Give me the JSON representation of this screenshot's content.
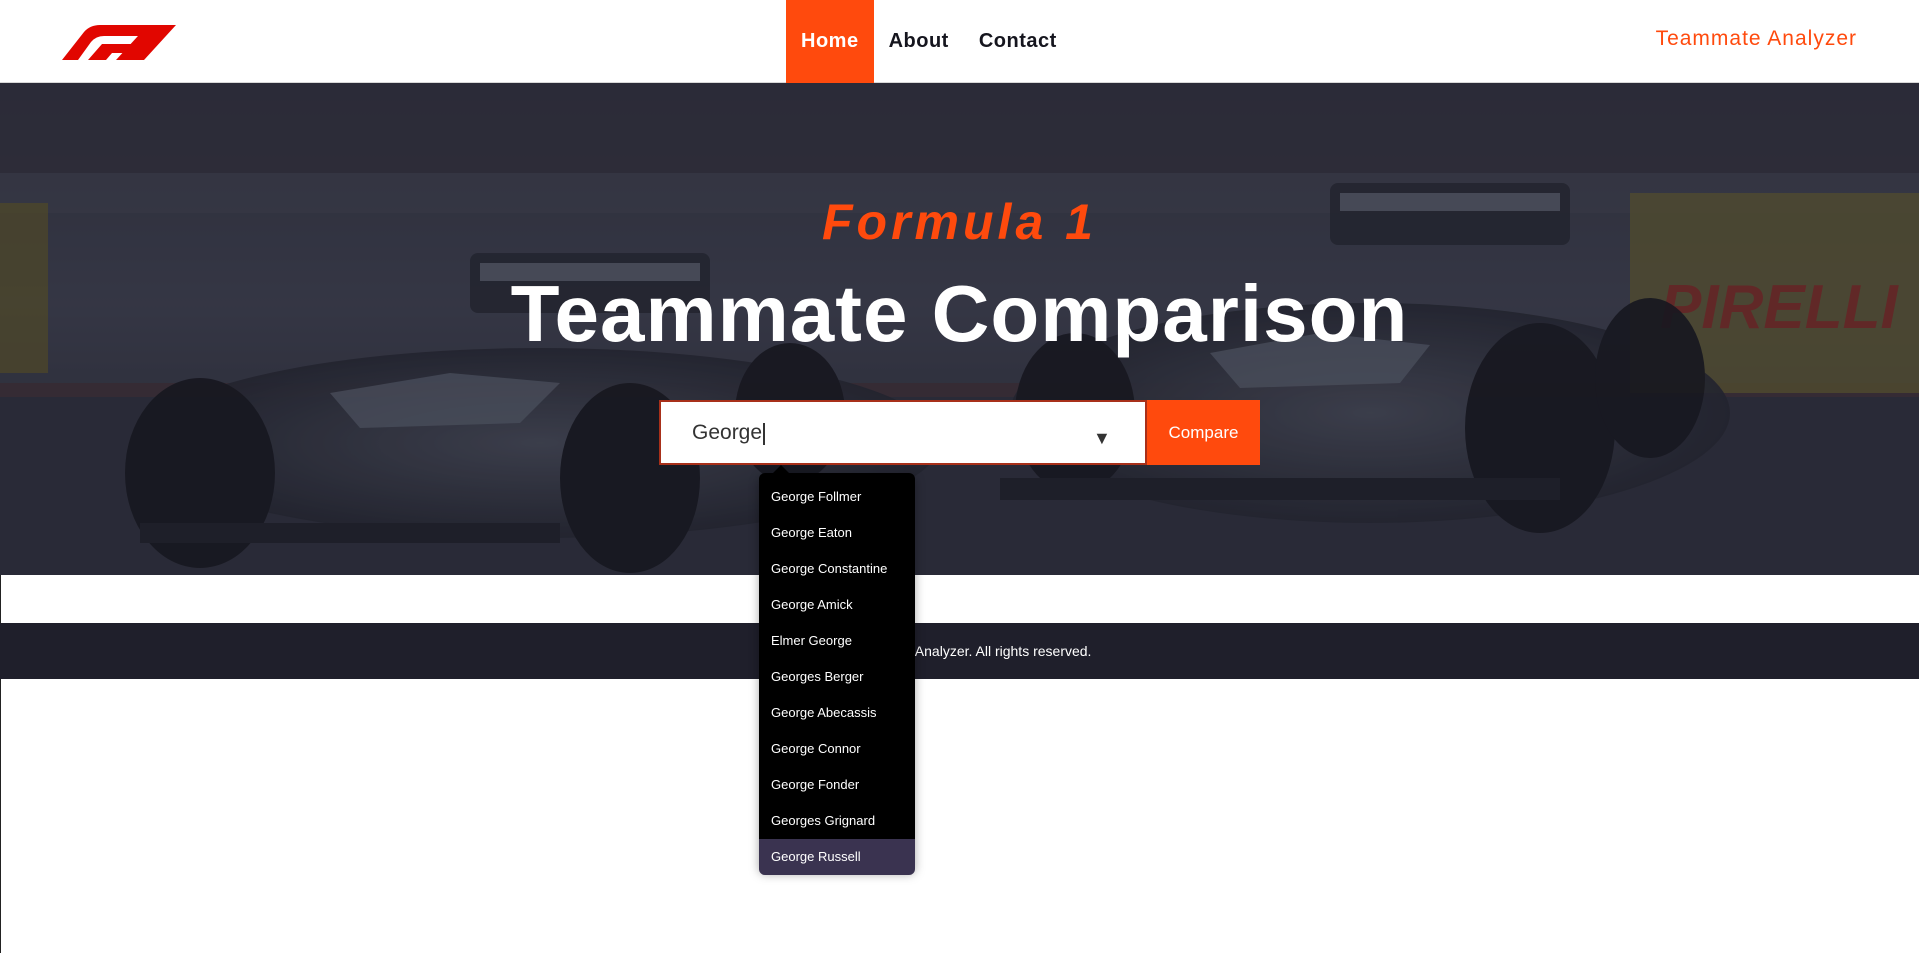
{
  "nav": {
    "links": [
      "Home",
      "About",
      "Contact"
    ],
    "brand": "Teammate Analyzer"
  },
  "hero": {
    "subtitle": "Formula 1",
    "title": "Teammate Comparison"
  },
  "search": {
    "value": "George",
    "arrow": "▼",
    "button": "Compare"
  },
  "dropdown": {
    "items": [
      "George Follmer",
      "George Eaton",
      "George Constantine",
      "George Amick",
      "Elmer George",
      "Georges Berger",
      "George Abecassis",
      "George Connor",
      "George Fonder",
      "Georges Grignard",
      "George Russell"
    ],
    "highlighted": "George Russell"
  },
  "footer": {
    "text": "mate Analyzer. All rights reserved."
  },
  "colors": {
    "accent": "#ff4a0d",
    "dark": "#15151e",
    "footer": "#1f1f2b",
    "dropdown_bg": "#000000",
    "highlight": "#3a3350"
  },
  "icons": {
    "logo": "f1-logo",
    "dropdown": "chevron-down-icon"
  }
}
